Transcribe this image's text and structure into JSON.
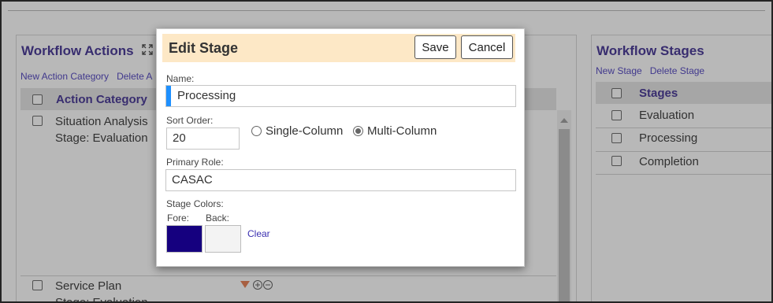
{
  "left_panel": {
    "title": "Workflow Actions",
    "links": [
      "New Action Category",
      "Delete A"
    ],
    "header": "Action Category",
    "rows": [
      {
        "line1": "Situation Analysis",
        "line2": "Stage: Evaluation"
      },
      {
        "line1": "Service Plan",
        "line2": "Stage: Evaluation"
      }
    ]
  },
  "right_panel": {
    "title": "Workflow Stages",
    "links": [
      "New Stage",
      "Delete Stage"
    ],
    "header": "Stages",
    "rows": [
      "Evaluation",
      "Processing",
      "Completion"
    ]
  },
  "dialog": {
    "title": "Edit Stage",
    "save_label": "Save",
    "cancel_label": "Cancel",
    "name_label": "Name:",
    "name_value": "Processing",
    "sort_label": "Sort Order:",
    "sort_value": "20",
    "single_column_label": "Single-Column",
    "multi_column_label": "Multi-Column",
    "layout_selected": "Multi-Column",
    "role_label": "Primary Role:",
    "role_value": "CASAC",
    "colors_label": "Stage Colors:",
    "fore_label": "Fore:",
    "back_label": "Back:",
    "fore_color": "#15007f",
    "back_color": "#f3f3f3",
    "clear_label": "Clear"
  }
}
